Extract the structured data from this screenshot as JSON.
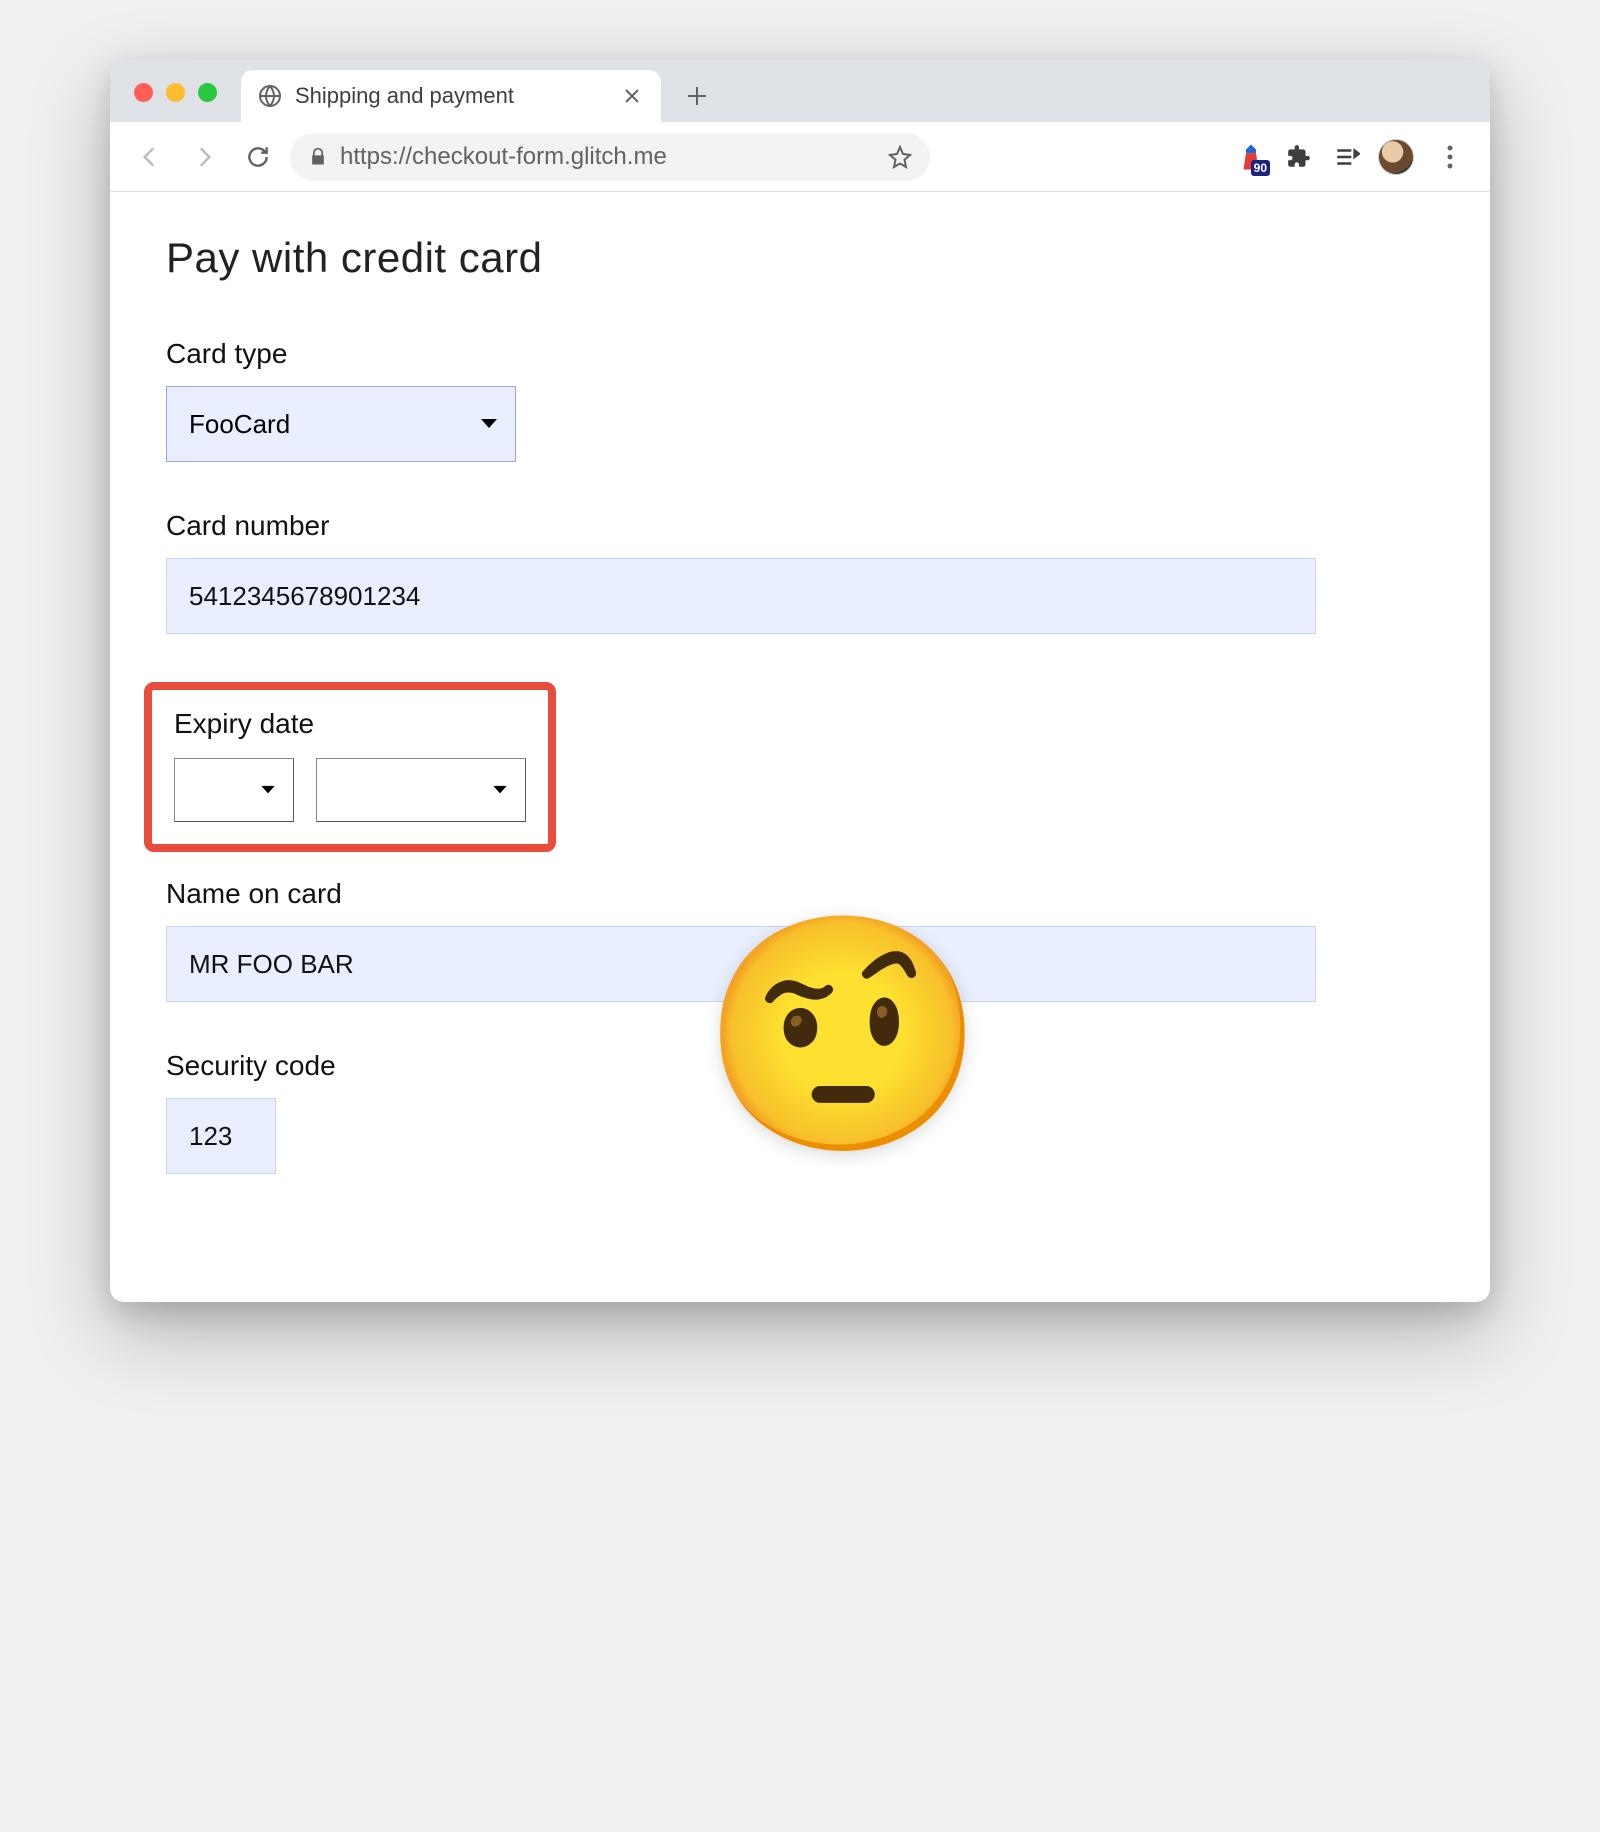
{
  "browser": {
    "tab_title": "Shipping and payment",
    "url": "https://checkout-form.glitch.me",
    "extension_badge": "90"
  },
  "page": {
    "heading": "Pay with credit card",
    "card_type": {
      "label": "Card type",
      "value": "FooCard"
    },
    "card_number": {
      "label": "Card number",
      "value": "5412345678901234"
    },
    "expiry": {
      "label": "Expiry date",
      "month": "",
      "year": ""
    },
    "name_on_card": {
      "label": "Name on card",
      "value": "MR FOO BAR"
    },
    "security_code": {
      "label": "Security code",
      "value": "123"
    },
    "emoji": "🤨"
  }
}
